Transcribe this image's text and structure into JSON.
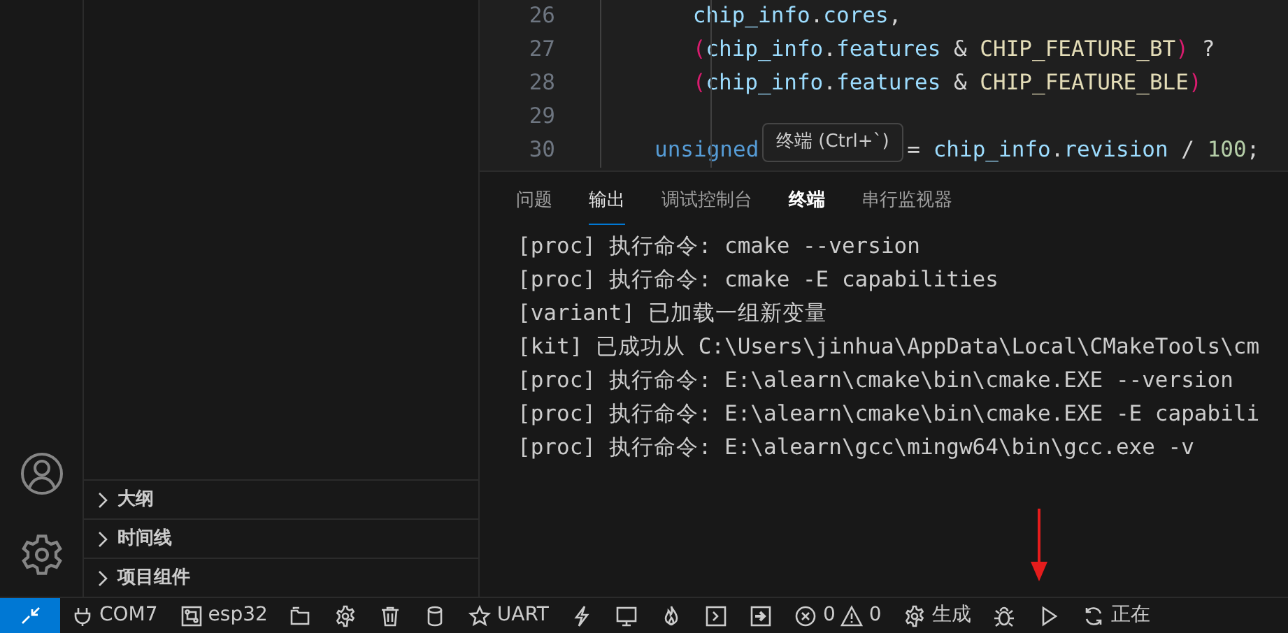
{
  "editor": {
    "lines": [
      {
        "number": "26",
        "segments": [
          {
            "tokens": [
              {
                "text": "       chip_info",
                "kind": "var"
              },
              {
                "text": ".",
                "kind": "op"
              },
              {
                "text": "cores",
                "kind": "var"
              },
              {
                "text": ",",
                "kind": "op"
              }
            ]
          }
        ]
      },
      {
        "number": "27",
        "segments": [
          {
            "tokens": [
              {
                "text": "       (",
                "kind": "paren"
              },
              {
                "text": "chip_info",
                "kind": "var"
              },
              {
                "text": ".",
                "kind": "op"
              },
              {
                "text": "features",
                "kind": "var"
              },
              {
                "text": " & ",
                "kind": "op"
              },
              {
                "text": "CHIP_FEATURE_BT",
                "kind": "const"
              },
              {
                "text": ")",
                "kind": "paren"
              },
              {
                "text": " ?",
                "kind": "op"
              }
            ]
          }
        ]
      },
      {
        "number": "28",
        "segments": [
          {
            "tokens": [
              {
                "text": "       (",
                "kind": "paren"
              },
              {
                "text": "chip_info",
                "kind": "var"
              },
              {
                "text": ".",
                "kind": "op"
              },
              {
                "text": "features",
                "kind": "var"
              },
              {
                "text": " & ",
                "kind": "op"
              },
              {
                "text": "CHIP_FEATURE_BLE",
                "kind": "const"
              },
              {
                "text": ")",
                "kind": "paren"
              }
            ]
          }
        ]
      },
      {
        "number": "29"
      },
      {
        "number": "30",
        "segments": [
          {
            "tokens": [
              {
                "text": "unsigned",
                "kind": "keyword"
              }
            ]
          },
          {
            "tokens": [
              {
                "text": "= ",
                "kind": "op"
              },
              {
                "text": "chip_info",
                "kind": "var"
              },
              {
                "text": ".",
                "kind": "op"
              },
              {
                "text": "revision",
                "kind": "var"
              },
              {
                "text": " / ",
                "kind": "op"
              },
              {
                "text": "100",
                "kind": "number"
              },
              {
                "text": ";",
                "kind": "op"
              }
            ]
          }
        ]
      }
    ]
  },
  "tooltip": {
    "text": "终端 (Ctrl+`)"
  },
  "panel": {
    "tabs": [
      {
        "label": "问题",
        "selected": false,
        "hovered": false
      },
      {
        "label": "输出",
        "selected": true,
        "hovered": false
      },
      {
        "label": "调试控制台",
        "selected": false,
        "hovered": false
      },
      {
        "label": "终端",
        "selected": false,
        "hovered": true
      },
      {
        "label": "串行监视器",
        "selected": false,
        "hovered": false
      }
    ],
    "output": [
      "[proc] 执行命令: cmake --version",
      "[proc] 执行命令: cmake -E capabilities",
      "[variant] 已加载一组新变量",
      "[kit] 已成功从 C:\\Users\\jinhua\\AppData\\Local\\CMakeTools\\cm",
      "[proc] 执行命令: E:\\alearn\\cmake\\bin\\cmake.EXE --version",
      "[proc] 执行命令: E:\\alearn\\cmake\\bin\\cmake.EXE -E capabili",
      "[proc] 执行命令: E:\\alearn\\gcc\\mingw64\\bin\\gcc.exe -v"
    ]
  },
  "sidebar": {
    "sections": [
      {
        "label": "大纲",
        "expanded": false
      },
      {
        "label": "时间线",
        "expanded": false
      },
      {
        "label": "项目组件",
        "expanded": false
      }
    ]
  },
  "status_bar": {
    "port": "COM7",
    "target": "esp32",
    "uart": "UART",
    "errors": "0",
    "warnings": "0",
    "build": "生成",
    "progress": "正在"
  }
}
